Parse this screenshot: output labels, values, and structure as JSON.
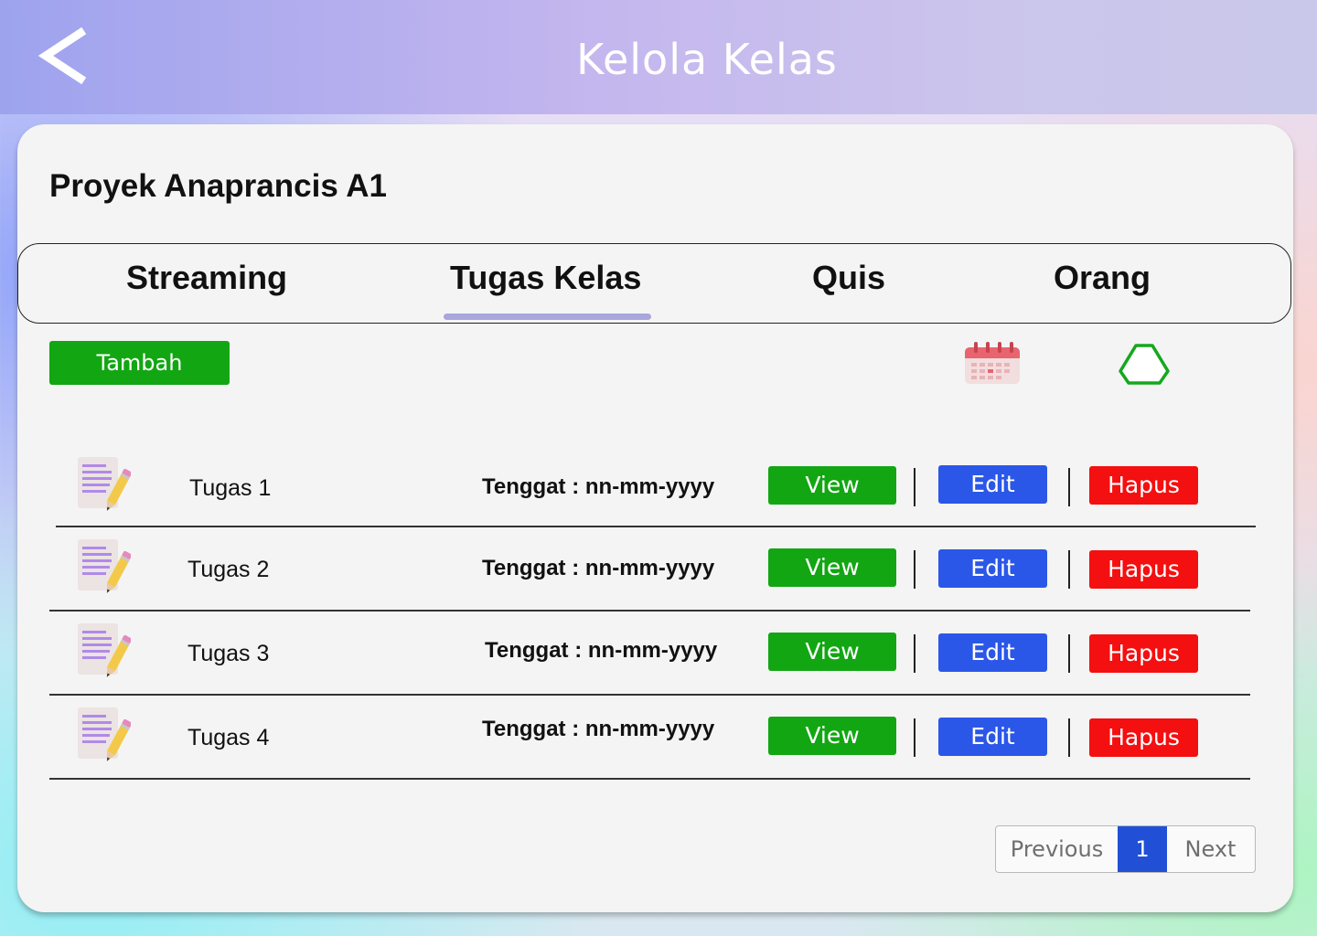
{
  "header": {
    "title": "Kelola Kelas",
    "back_icon": "chevron-left-icon"
  },
  "class": {
    "name": "Proyek Anaprancis A1"
  },
  "tabs": [
    {
      "label": "Streaming",
      "active": false
    },
    {
      "label": "Tugas Kelas",
      "active": true
    },
    {
      "label": "Quis",
      "active": false
    },
    {
      "label": "Orang",
      "active": false
    }
  ],
  "toolbar": {
    "add_label": "Tambah",
    "calendar_icon": "calendar-icon",
    "drive_icon": "google-drive-icon"
  },
  "tasks": [
    {
      "name": "Tugas 1",
      "deadline": "Tenggat : nn-mm-yyyy",
      "view": "View",
      "edit": "Edit",
      "delete": "Hapus"
    },
    {
      "name": "Tugas 2",
      "deadline": "Tenggat : nn-mm-yyyy",
      "view": "View",
      "edit": "Edit",
      "delete": "Hapus"
    },
    {
      "name": "Tugas 3",
      "deadline": "Tenggat : nn-mm-yyyy",
      "view": "View",
      "edit": "Edit",
      "delete": "Hapus"
    },
    {
      "name": "Tugas 4",
      "deadline": "Tenggat : nn-mm-yyyy",
      "view": "View",
      "edit": "Edit",
      "delete": "Hapus"
    }
  ],
  "pagination": {
    "previous": "Previous",
    "current": "1",
    "next": "Next"
  },
  "colors": {
    "green": "#12a613",
    "blue": "#2b57e8",
    "red": "#f40f10",
    "tab_underline": "#a9a6dc",
    "pagination_active": "#2150d6"
  }
}
